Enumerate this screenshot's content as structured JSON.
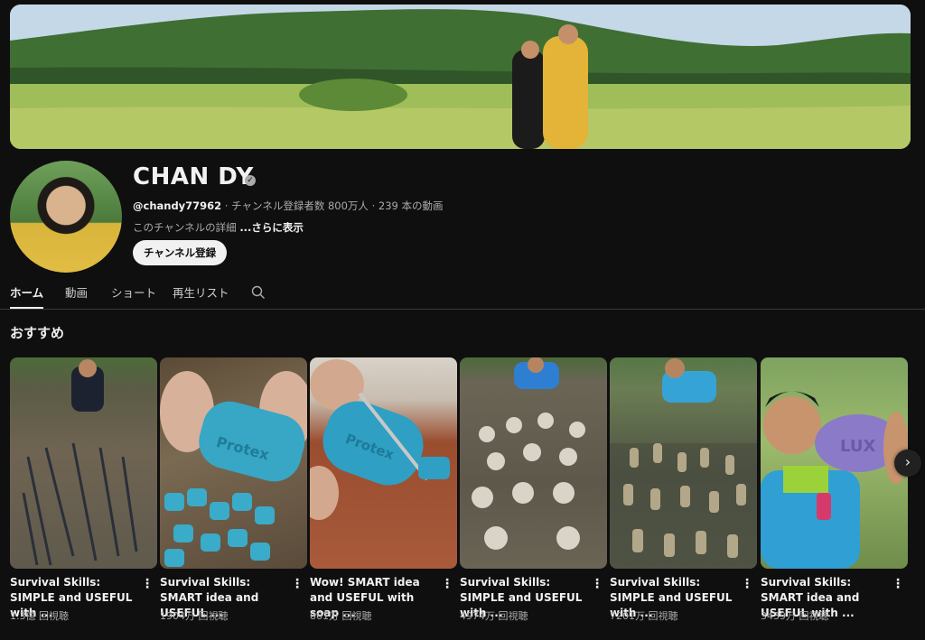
{
  "channel": {
    "name": "CHAN DY",
    "verified_icon": "verified-check-icon",
    "handle": "@chandy77962",
    "stats": " · チャンネル登録者数 800万人 · 239 本の動画",
    "description": "このチャンネルの詳細 ",
    "more_label": "...さらに表示",
    "subscribe_label": "チャンネル登録"
  },
  "tabs": [
    {
      "label": "ホーム",
      "active": true
    },
    {
      "label": "動画",
      "active": false
    },
    {
      "label": "ショート",
      "active": false
    },
    {
      "label": "再生リスト",
      "active": false
    }
  ],
  "section": {
    "title": "おすすめ"
  },
  "videos": [
    {
      "title": "Survival Skills: SIMPLE and USEFUL with ...",
      "views": "1.3億 回視聴"
    },
    {
      "title": "Survival Skills: SMART idea and USEFUL ...",
      "views": "1904万 回視聴"
    },
    {
      "title": "Wow! SMART idea and USEFUL with soap ...",
      "views": "861万 回視聴"
    },
    {
      "title": "Survival Skills: SIMPLE and USEFUL with ...",
      "views": "4974万 回視聴"
    },
    {
      "title": "Survival Skills: SIMPLE and USEFUL with ...",
      "views": "7201万 回視聴"
    },
    {
      "title": "Survival Skills: SMART idea and USEFUL with ...",
      "views": "3439万 回視聴"
    }
  ],
  "thumb_texts": {
    "protex": "Protex",
    "lux": "LUX"
  },
  "colors": {
    "background": "#0f0f0f",
    "text": "#f1f1f1",
    "secondary": "#aaaaaa",
    "button_bg": "#f1f1f1"
  }
}
